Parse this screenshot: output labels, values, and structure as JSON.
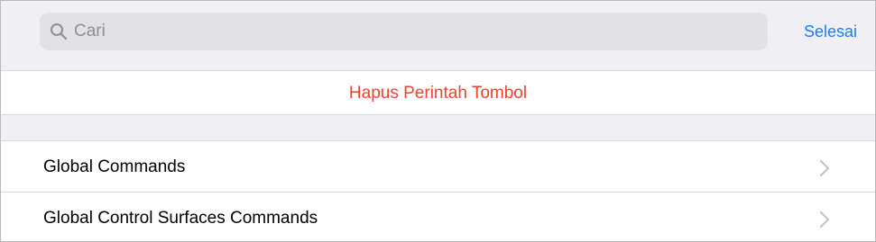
{
  "search": {
    "placeholder": "Cari",
    "icon": "search-icon"
  },
  "header": {
    "done_label": "Selesai"
  },
  "delete_action": {
    "label": "Hapus Perintah Tombol"
  },
  "list": {
    "items": [
      {
        "label": "Global Commands",
        "icon": "chevron-right-icon"
      },
      {
        "label": "Global Control Surfaces Commands",
        "icon": "chevron-right-icon"
      }
    ]
  },
  "colors": {
    "accent": "#1b7cf0",
    "destructive": "#f0412f",
    "background": "#efeff4",
    "search_fill": "#e1e1e6"
  }
}
